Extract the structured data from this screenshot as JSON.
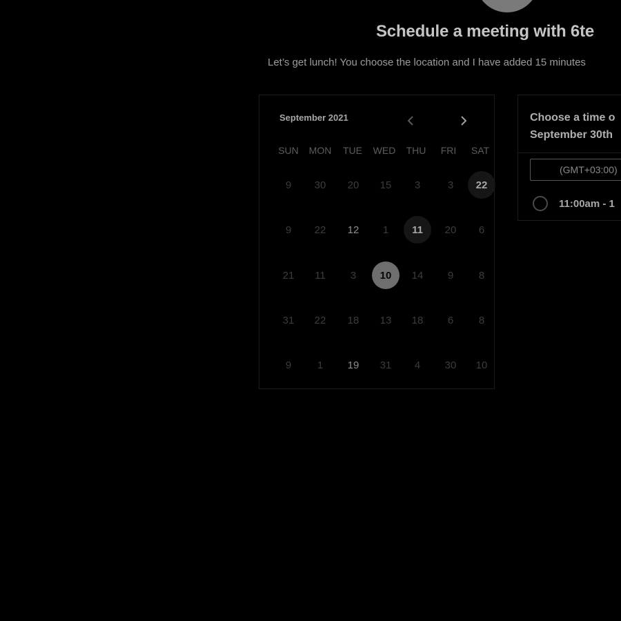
{
  "header": {
    "title": "Schedule a meeting with 6te",
    "subtitle": "Let’s get lunch! You choose the location and I have added 15 minutes"
  },
  "calendar": {
    "month_label": "September 2021",
    "prev_icon": "chevron-left-icon",
    "next_icon": "chevron-right-icon",
    "weekdays": [
      "SUN",
      "MON",
      "TUE",
      "WED",
      "THU",
      "FRI",
      "SAT"
    ],
    "weeks": [
      [
        {
          "label": "9",
          "state": "dim"
        },
        {
          "label": "30",
          "state": "dim"
        },
        {
          "label": "20",
          "state": "dim"
        },
        {
          "label": "15",
          "state": "dim"
        },
        {
          "label": "3",
          "state": "dim"
        },
        {
          "label": "3",
          "state": "dim"
        },
        {
          "label": "22",
          "state": "available"
        }
      ],
      [
        {
          "label": "9",
          "state": "dim"
        },
        {
          "label": "22",
          "state": "dim"
        },
        {
          "label": "12",
          "state": "medium"
        },
        {
          "label": "1",
          "state": "dim"
        },
        {
          "label": "11",
          "state": "available"
        },
        {
          "label": "20",
          "state": "dim"
        },
        {
          "label": "6",
          "state": "dim"
        }
      ],
      [
        {
          "label": "21",
          "state": "dim"
        },
        {
          "label": "11",
          "state": "dim"
        },
        {
          "label": "3",
          "state": "dim"
        },
        {
          "label": "10",
          "state": "selected"
        },
        {
          "label": "14",
          "state": "dim"
        },
        {
          "label": "9",
          "state": "dim"
        },
        {
          "label": "8",
          "state": "dim"
        }
      ],
      [
        {
          "label": "31",
          "state": "dim"
        },
        {
          "label": "22",
          "state": "dim"
        },
        {
          "label": "18",
          "state": "dim"
        },
        {
          "label": "13",
          "state": "dim"
        },
        {
          "label": "18",
          "state": "dim"
        },
        {
          "label": "6",
          "state": "dim"
        },
        {
          "label": "8",
          "state": "dim"
        }
      ],
      [
        {
          "label": "9",
          "state": "dim"
        },
        {
          "label": "1",
          "state": "dim"
        },
        {
          "label": "19",
          "state": "medium"
        },
        {
          "label": "31",
          "state": "dim"
        },
        {
          "label": "4",
          "state": "dim"
        },
        {
          "label": "30",
          "state": "dim"
        },
        {
          "label": "10",
          "state": "dim"
        }
      ]
    ]
  },
  "time_panel": {
    "heading_line1": "Choose a time o",
    "heading_line2": "September 30th",
    "timezone": "(GMT+03:00)",
    "slots": [
      {
        "label": "11:00am - 1",
        "selected": false
      }
    ]
  },
  "colors": {
    "background": "#000000",
    "selected_day": "#6e6e6e",
    "available_day": "#161616",
    "title_text": "#c4c4c4"
  }
}
